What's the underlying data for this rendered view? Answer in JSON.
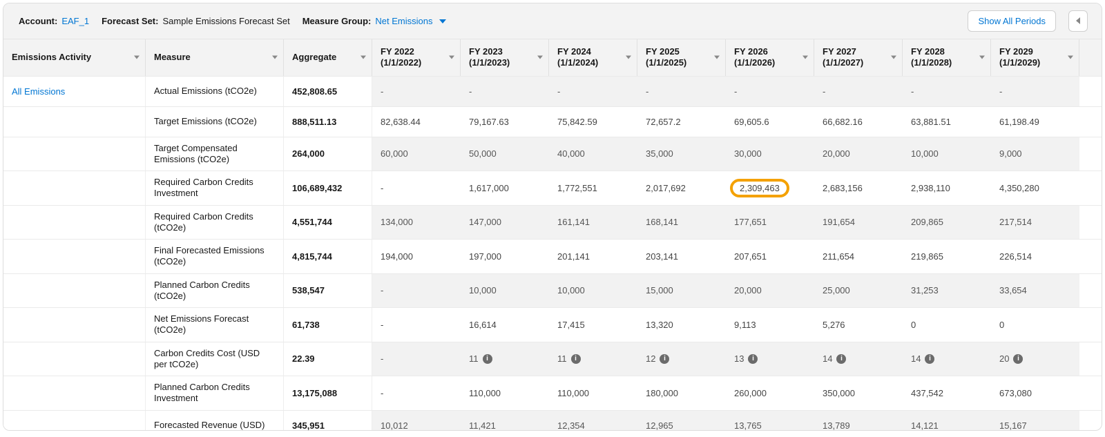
{
  "header": {
    "account_label": "Account:",
    "account_value": "EAF_1",
    "forecast_label": "Forecast Set:",
    "forecast_value": "Sample Emissions Forecast Set",
    "measure_group_label": "Measure Group:",
    "measure_group_value": "Net Emissions",
    "show_all_periods": "Show All Periods"
  },
  "columns": {
    "activity": "Emissions Activity",
    "measure": "Measure",
    "aggregate": "Aggregate",
    "fy": [
      {
        "line1": "FY 2022",
        "line2": "(1/1/2022)"
      },
      {
        "line1": "FY 2023",
        "line2": "(1/1/2023)"
      },
      {
        "line1": "FY 2024",
        "line2": "(1/1/2024)"
      },
      {
        "line1": "FY 2025",
        "line2": "(1/1/2025)"
      },
      {
        "line1": "FY 2026",
        "line2": "(1/1/2026)"
      },
      {
        "line1": "FY 2027",
        "line2": "(1/1/2027)"
      },
      {
        "line1": "FY 2028",
        "line2": "(1/1/2028)"
      },
      {
        "line1": "FY 2029",
        "line2": "(1/1/2029)"
      }
    ]
  },
  "activity_link": "All Emissions",
  "rows": [
    {
      "measure": "Actual Emissions (tCO2e)",
      "aggregate": "452,808.65",
      "values": [
        "-",
        "-",
        "-",
        "-",
        "-",
        "-",
        "-",
        "-"
      ],
      "info": []
    },
    {
      "measure": "Target Emissions (tCO2e)",
      "aggregate": "888,511.13",
      "values": [
        "82,638.44",
        "79,167.63",
        "75,842.59",
        "72,657.2",
        "69,605.6",
        "66,682.16",
        "63,881.51",
        "61,198.49"
      ],
      "info": []
    },
    {
      "measure": "Target Compensated Emissions (tCO2e)",
      "aggregate": "264,000",
      "values": [
        "60,000",
        "50,000",
        "40,000",
        "35,000",
        "30,000",
        "20,000",
        "10,000",
        "9,000"
      ],
      "info": []
    },
    {
      "measure": "Required Carbon Credits Investment",
      "aggregate": "106,689,432",
      "values": [
        "-",
        "1,617,000",
        "1,772,551",
        "2,017,692",
        "2,309,463",
        "2,683,156",
        "2,938,110",
        "4,350,280"
      ],
      "info": [],
      "highlight": 4
    },
    {
      "measure": "Required Carbon Credits (tCO2e)",
      "aggregate": "4,551,744",
      "values": [
        "134,000",
        "147,000",
        "161,141",
        "168,141",
        "177,651",
        "191,654",
        "209,865",
        "217,514"
      ],
      "info": []
    },
    {
      "measure": "Final Forecasted Emissions (tCO2e)",
      "aggregate": "4,815,744",
      "values": [
        "194,000",
        "197,000",
        "201,141",
        "203,141",
        "207,651",
        "211,654",
        "219,865",
        "226,514"
      ],
      "info": []
    },
    {
      "measure": "Planned Carbon Credits (tCO2e)",
      "aggregate": "538,547",
      "values": [
        "-",
        "10,000",
        "10,000",
        "15,000",
        "20,000",
        "25,000",
        "31,253",
        "33,654"
      ],
      "info": []
    },
    {
      "measure": "Net Emissions Forecast (tCO2e)",
      "aggregate": "61,738",
      "values": [
        "-",
        "16,614",
        "17,415",
        "13,320",
        "9,113",
        "5,276",
        "0",
        "0"
      ],
      "info": []
    },
    {
      "measure": "Carbon Credits Cost (USD per tCO2e)",
      "aggregate": "22.39",
      "values": [
        "-",
        "11",
        "11",
        "12",
        "13",
        "14",
        "14",
        "20"
      ],
      "info": [
        1,
        2,
        3,
        4,
        5,
        6,
        7
      ]
    },
    {
      "measure": "Planned Carbon Credits Investment",
      "aggregate": "13,175,088",
      "values": [
        "-",
        "110,000",
        "110,000",
        "180,000",
        "260,000",
        "350,000",
        "437,542",
        "673,080"
      ],
      "info": []
    },
    {
      "measure": "Forecasted Revenue (USD)",
      "aggregate": "345,951",
      "values": [
        "10,012",
        "11,421",
        "12,354",
        "12,965",
        "13,765",
        "13,789",
        "14,121",
        "15,167"
      ],
      "info": []
    }
  ]
}
